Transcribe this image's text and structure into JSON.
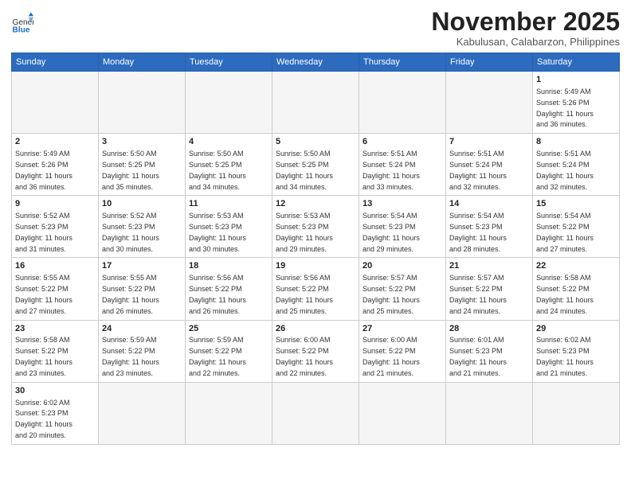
{
  "header": {
    "logo_general": "General",
    "logo_blue": "Blue",
    "month_title": "November 2025",
    "subtitle": "Kabulusan, Calabarzon, Philippines"
  },
  "weekdays": [
    "Sunday",
    "Monday",
    "Tuesday",
    "Wednesday",
    "Thursday",
    "Friday",
    "Saturday"
  ],
  "days": {
    "1": {
      "sunrise": "5:49 AM",
      "sunset": "5:26 PM",
      "daylight": "11 hours and 36 minutes."
    },
    "2": {
      "sunrise": "5:49 AM",
      "sunset": "5:26 PM",
      "daylight": "11 hours and 36 minutes."
    },
    "3": {
      "sunrise": "5:50 AM",
      "sunset": "5:25 PM",
      "daylight": "11 hours and 35 minutes."
    },
    "4": {
      "sunrise": "5:50 AM",
      "sunset": "5:25 PM",
      "daylight": "11 hours and 34 minutes."
    },
    "5": {
      "sunrise": "5:50 AM",
      "sunset": "5:25 PM",
      "daylight": "11 hours and 34 minutes."
    },
    "6": {
      "sunrise": "5:51 AM",
      "sunset": "5:24 PM",
      "daylight": "11 hours and 33 minutes."
    },
    "7": {
      "sunrise": "5:51 AM",
      "sunset": "5:24 PM",
      "daylight": "11 hours and 32 minutes."
    },
    "8": {
      "sunrise": "5:51 AM",
      "sunset": "5:24 PM",
      "daylight": "11 hours and 32 minutes."
    },
    "9": {
      "sunrise": "5:52 AM",
      "sunset": "5:23 PM",
      "daylight": "11 hours and 31 minutes."
    },
    "10": {
      "sunrise": "5:52 AM",
      "sunset": "5:23 PM",
      "daylight": "11 hours and 30 minutes."
    },
    "11": {
      "sunrise": "5:53 AM",
      "sunset": "5:23 PM",
      "daylight": "11 hours and 30 minutes."
    },
    "12": {
      "sunrise": "5:53 AM",
      "sunset": "5:23 PM",
      "daylight": "11 hours and 29 minutes."
    },
    "13": {
      "sunrise": "5:54 AM",
      "sunset": "5:23 PM",
      "daylight": "11 hours and 29 minutes."
    },
    "14": {
      "sunrise": "5:54 AM",
      "sunset": "5:23 PM",
      "daylight": "11 hours and 28 minutes."
    },
    "15": {
      "sunrise": "5:54 AM",
      "sunset": "5:22 PM",
      "daylight": "11 hours and 27 minutes."
    },
    "16": {
      "sunrise": "5:55 AM",
      "sunset": "5:22 PM",
      "daylight": "11 hours and 27 minutes."
    },
    "17": {
      "sunrise": "5:55 AM",
      "sunset": "5:22 PM",
      "daylight": "11 hours and 26 minutes."
    },
    "18": {
      "sunrise": "5:56 AM",
      "sunset": "5:22 PM",
      "daylight": "11 hours and 26 minutes."
    },
    "19": {
      "sunrise": "5:56 AM",
      "sunset": "5:22 PM",
      "daylight": "11 hours and 25 minutes."
    },
    "20": {
      "sunrise": "5:57 AM",
      "sunset": "5:22 PM",
      "daylight": "11 hours and 25 minutes."
    },
    "21": {
      "sunrise": "5:57 AM",
      "sunset": "5:22 PM",
      "daylight": "11 hours and 24 minutes."
    },
    "22": {
      "sunrise": "5:58 AM",
      "sunset": "5:22 PM",
      "daylight": "11 hours and 24 minutes."
    },
    "23": {
      "sunrise": "5:58 AM",
      "sunset": "5:22 PM",
      "daylight": "11 hours and 23 minutes."
    },
    "24": {
      "sunrise": "5:59 AM",
      "sunset": "5:22 PM",
      "daylight": "11 hours and 23 minutes."
    },
    "25": {
      "sunrise": "5:59 AM",
      "sunset": "5:22 PM",
      "daylight": "11 hours and 22 minutes."
    },
    "26": {
      "sunrise": "6:00 AM",
      "sunset": "5:22 PM",
      "daylight": "11 hours and 22 minutes."
    },
    "27": {
      "sunrise": "6:00 AM",
      "sunset": "5:22 PM",
      "daylight": "11 hours and 21 minutes."
    },
    "28": {
      "sunrise": "6:01 AM",
      "sunset": "5:23 PM",
      "daylight": "11 hours and 21 minutes."
    },
    "29": {
      "sunrise": "6:02 AM",
      "sunset": "5:23 PM",
      "daylight": "11 hours and 21 minutes."
    },
    "30": {
      "sunrise": "6:02 AM",
      "sunset": "5:23 PM",
      "daylight": "11 hours and 20 minutes."
    }
  }
}
